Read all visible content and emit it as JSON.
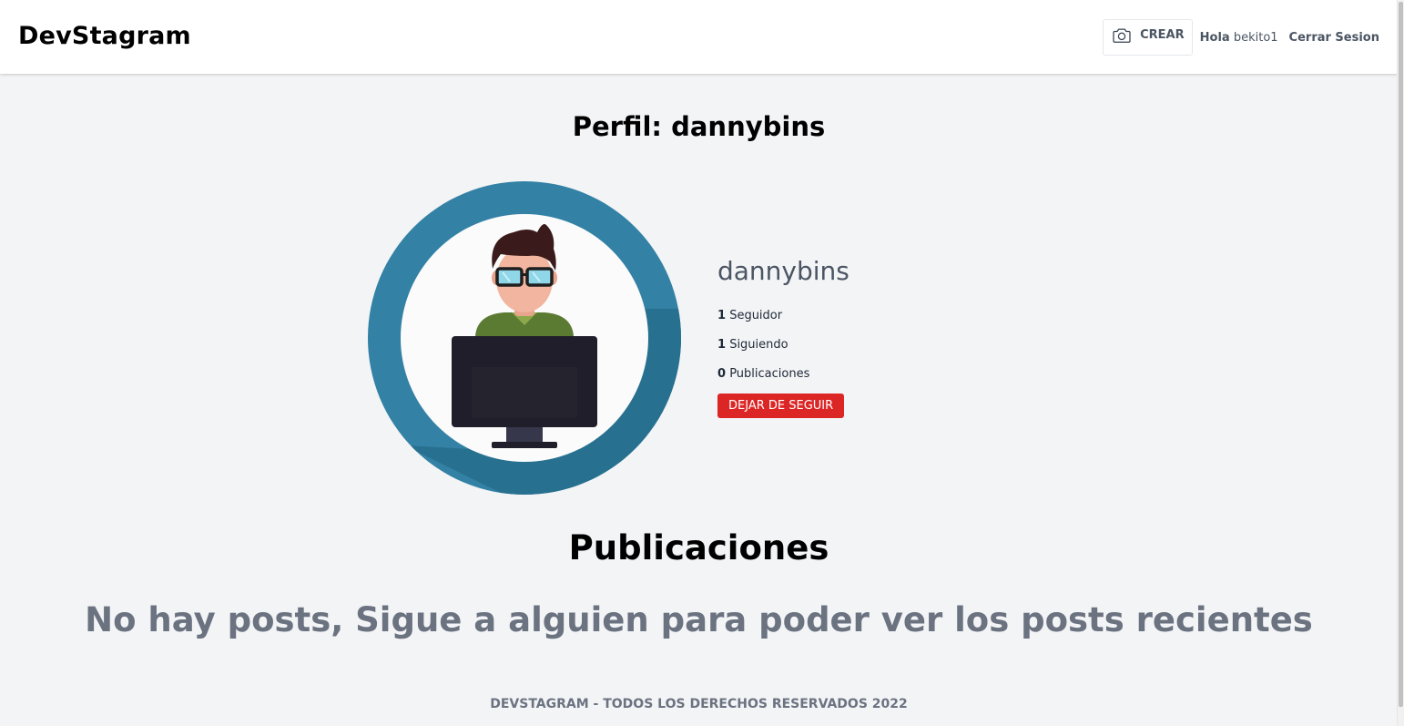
{
  "header": {
    "logo": "DevStagram",
    "create_label": "CREAR",
    "greeting_prefix": "Hola",
    "greeting_user": "bekito1",
    "logout_label": "Cerrar Sesion"
  },
  "profile": {
    "title": "Perfil: dannybins",
    "username": "dannybins",
    "followers_count": "1",
    "followers_label": "Seguidor",
    "following_count": "1",
    "following_label": "Siguiendo",
    "posts_count": "0",
    "posts_label": "Publicaciones",
    "unfollow_label": "DEJAR DE SEGUIR"
  },
  "posts": {
    "heading": "Publicaciones",
    "empty_message": "No hay posts, Sigue a alguien para poder ver los posts recientes"
  },
  "footer": {
    "text": "DEVSTAGRAM - TODOS LOS DERECHOS RESERVADOS 2022"
  },
  "colors": {
    "background": "#f3f4f6",
    "unfollow_button": "#dc2626",
    "avatar_ring": "#3381a5",
    "muted_text": "#6b7280"
  },
  "icons": {
    "create": "camera-icon",
    "avatar": "developer-avatar-icon"
  }
}
